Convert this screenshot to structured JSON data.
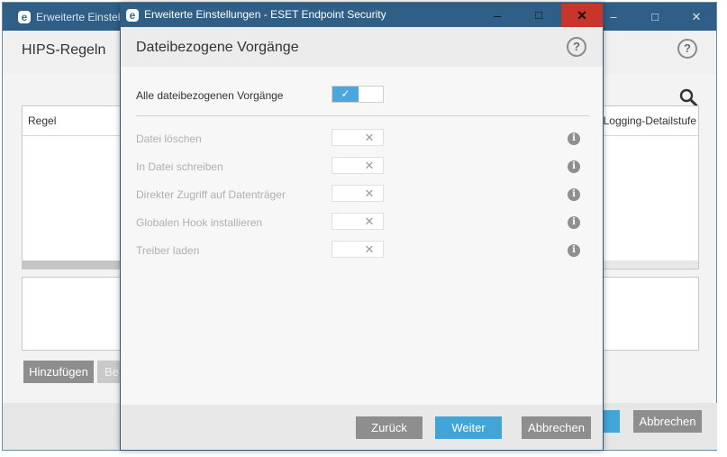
{
  "background_window": {
    "title": "Erweiterte Einstell",
    "heading": "HIPS-Regeln",
    "help_glyph": "?",
    "controls": {
      "minimize": "–",
      "maximize": "□",
      "close": "✕"
    },
    "table": {
      "columns": [
        "Regel",
        "Logging-Detailstufe"
      ]
    },
    "buttons": {
      "add": "Hinzufügen",
      "edit": "Be",
      "cancel": "Abbrechen"
    }
  },
  "dialog": {
    "title": "Erweiterte Einstellungen - ESET Endpoint Security",
    "logo_glyph": "e",
    "controls": {
      "minimize": "–",
      "maximize": "□",
      "close": "✕"
    },
    "heading": "Dateibezogene Vorgänge",
    "help_glyph": "?",
    "master": {
      "label": "Alle dateibezogenen Vorgänge",
      "checked": true,
      "check_glyph": "✓"
    },
    "rows": [
      {
        "label": "Datei löschen",
        "checked": false,
        "enabled": false
      },
      {
        "label": "In Datei schreiben",
        "checked": false,
        "enabled": false
      },
      {
        "label": "Direkter Zugriff auf Datenträger",
        "checked": false,
        "enabled": false
      },
      {
        "label": "Globalen Hook installieren",
        "checked": false,
        "enabled": false
      },
      {
        "label": "Treiber laden",
        "checked": false,
        "enabled": false
      }
    ],
    "off_glyph": "✕",
    "info_glyph": "i",
    "buttons": {
      "back": "Zurück",
      "next": "Weiter",
      "cancel": "Abbrechen"
    }
  },
  "colors": {
    "titlebar": "#2f5f86",
    "accent": "#42a5d8",
    "close_red": "#c8352b",
    "button_gray": "#8e8e8e"
  }
}
